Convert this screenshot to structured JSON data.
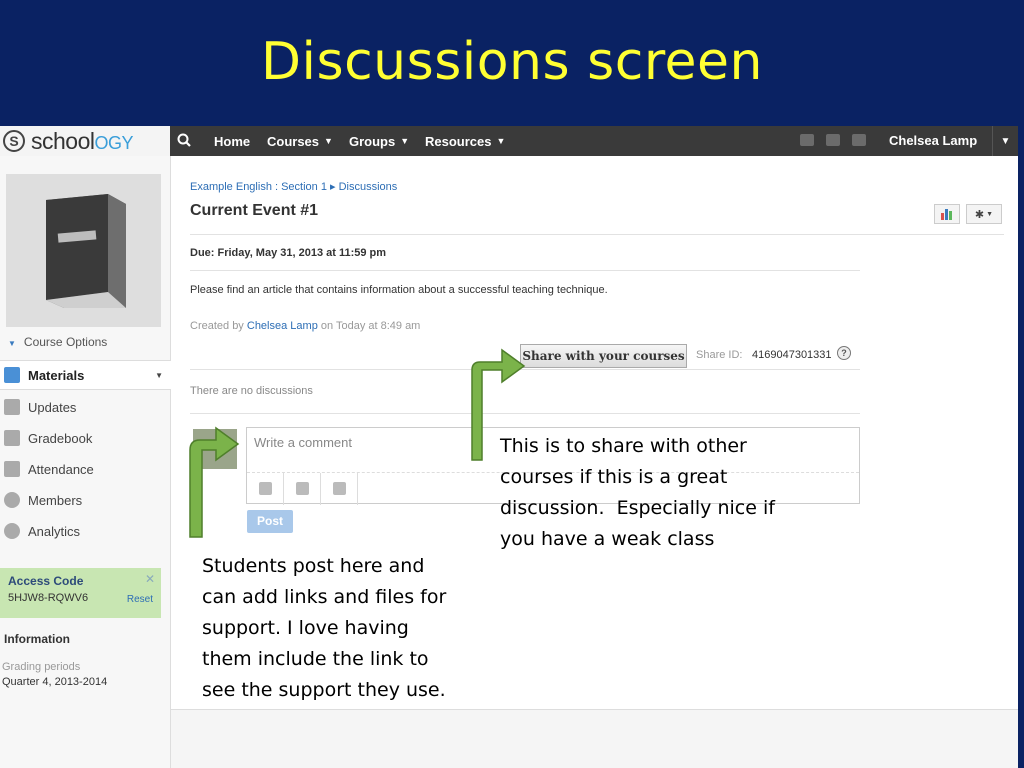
{
  "slide": {
    "title": "Discussions screen"
  },
  "topbar": {
    "logo": {
      "s": "S",
      "school": "school",
      "ogy": "OGY"
    },
    "nav": [
      {
        "label": "Home"
      },
      {
        "label": "Courses"
      },
      {
        "label": "Groups"
      },
      {
        "label": "Resources"
      }
    ],
    "user": "Chelsea Lamp"
  },
  "sidebar": {
    "course_options": "Course Options",
    "items": [
      {
        "label": "Materials",
        "icon": "materials-icon"
      },
      {
        "label": "Updates",
        "icon": "updates-icon"
      },
      {
        "label": "Gradebook",
        "icon": "gradebook-icon"
      },
      {
        "label": "Attendance",
        "icon": "attendance-icon"
      },
      {
        "label": "Members",
        "icon": "members-icon"
      },
      {
        "label": "Analytics",
        "icon": "analytics-icon"
      }
    ],
    "access_code": {
      "title": "Access Code",
      "code": "5HJW8-RQWV6",
      "reset": "Reset"
    },
    "information": {
      "title": "Information",
      "grading_label": "Grading periods",
      "grading_value": "Quarter 4, 2013-2014"
    }
  },
  "main": {
    "breadcrumb": "Example English : Section 1 ▸ Discussions",
    "title": "Current Event #1",
    "due": "Due: Friday, May 31, 2013 at 11:59 pm",
    "description": "Please find an article that contains information about a successful teaching technique.",
    "created_prefix": "Created by ",
    "created_author": "Chelsea Lamp",
    "created_suffix": " on Today at 8:49 am",
    "share_button": "Share with your courses",
    "share_id_label": "Share ID:",
    "share_id_value": "4169047301331",
    "no_discussions": "There are no discussions",
    "comment_placeholder": "Write a comment",
    "post_button": "Post"
  },
  "annotations": {
    "share_note": [
      "This is to share with other",
      "courses if this is a great",
      "discussion.  Especially nice if",
      "you have a weak class"
    ],
    "post_note": [
      "Students post here and",
      "can add links and files for",
      "support. I love having",
      "them include the link to",
      "see the support they use."
    ]
  },
  "colors": {
    "slide_bg": "#0a2263",
    "title": "#ffff33",
    "topbar": "#3a3a3a",
    "link": "#2d6eb5",
    "arrow": "#7bb34a"
  }
}
